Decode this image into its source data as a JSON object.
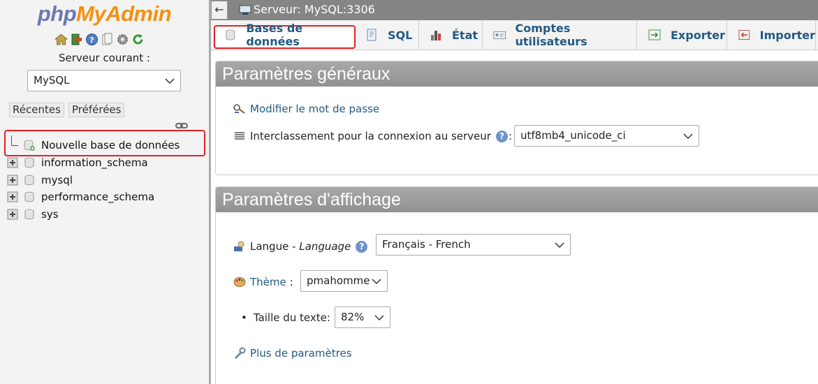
{
  "app": {
    "logo_php": "php",
    "logo_myadmin": "MyAdmin"
  },
  "nav": {
    "server_label": "Serveur courant :",
    "server_value": "MySQL",
    "recent_label": "Récentes",
    "favorites_label": "Préférées",
    "icons": [
      "home-icon",
      "exit-icon",
      "help-icon",
      "docs-icon",
      "settings-icon",
      "reload-icon"
    ],
    "tree": [
      {
        "label": "Nouvelle base de données",
        "icon": "new-db-icon"
      },
      {
        "label": "information_schema",
        "icon": "database-icon"
      },
      {
        "label": "mysql",
        "icon": "database-icon"
      },
      {
        "label": "performance_schema",
        "icon": "database-icon"
      },
      {
        "label": "sys",
        "icon": "database-icon"
      }
    ]
  },
  "topbar": {
    "back": "←",
    "breadcrumb": "Serveur: MySQL:3306"
  },
  "tabs": [
    {
      "label": "Bases de données",
      "active": true
    },
    {
      "label": "SQL",
      "active": false
    },
    {
      "label": "État",
      "active": false
    },
    {
      "label": "Comptes utilisateurs",
      "active": false
    },
    {
      "label": "Exporter",
      "active": false
    },
    {
      "label": "Importer",
      "active": false
    }
  ],
  "general": {
    "title": "Paramètres généraux",
    "change_password": "Modifier le mot de passe",
    "collation_label": "Interclassement pour la connexion au serveur",
    "collation_colon": ":",
    "collation_value": "utf8mb4_unicode_ci"
  },
  "display": {
    "title": "Paramètres d'affichage",
    "language_label": "Langue - ",
    "language_label_em": "Language",
    "language_value": "Français - French",
    "theme_label": "Thème",
    "theme_colon": ":",
    "theme_value": "pmahomme",
    "font_size_label": "Taille du texte:",
    "font_size_value": "82%",
    "more_settings": "Plus de paramètres"
  },
  "colors": {
    "link": "#235a81",
    "highlight": "#dd2222",
    "header": "#999999"
  }
}
